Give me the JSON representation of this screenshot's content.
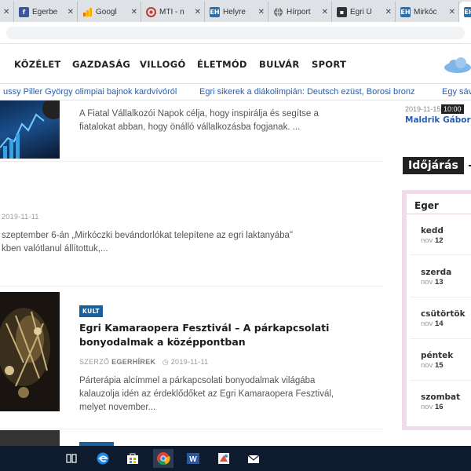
{
  "tabs": [
    {
      "title": "",
      "fav": "x-icon",
      "color": "#dee1e6"
    },
    {
      "title": "Egerbe",
      "fav": "facebook-icon",
      "color": "#3b5998"
    },
    {
      "title": "Googl",
      "fav": "google-analytics-icon",
      "color": "#f9ab00"
    },
    {
      "title": "MTI - n",
      "fav": "mti-icon",
      "color": "#c0392b"
    },
    {
      "title": "Helyre",
      "fav": "eh-icon",
      "color": "#2a6fb0"
    },
    {
      "title": "Hírport",
      "fav": "globe-icon",
      "color": "#777777"
    },
    {
      "title": "Egri Ü",
      "fav": "page-icon",
      "color": "#333333"
    },
    {
      "title": "Mirkóc",
      "fav": "eh-icon",
      "color": "#2a6fb0"
    },
    {
      "title": "",
      "fav": "eh-icon",
      "color": "#2a6fb0"
    }
  ],
  "nav": [
    "KÖZÉLET",
    "GAZDASÁG",
    "VILLOGÓ",
    "ÉLETMÓD",
    "BULVÁR",
    "SPORT"
  ],
  "ticker": [
    "ussy Piller György olimpiai bajnok kardvívóról",
    "Egri sikerek a diákolimpián: Deutsch ezüst, Borosi bronz",
    "Egy sáv"
  ],
  "articles": {
    "a1": {
      "excerpt": [
        "A Fiatal Vállalkozói Napok célja, hogy inspirálja és segítse a",
        "fiatalokat abban, hogy önálló vállalkozásba fogjanak. ..."
      ]
    },
    "a2": {
      "date": "2019-11-11",
      "excerpt": [
        "szeptember 6-án „Mirkóczki bevándorlókat telepítene az egri laktanyába\"",
        "kben valótlanul állítottuk,..."
      ]
    },
    "a3": {
      "badge": "KULT",
      "headline": [
        "Egri Kamaraopera Fesztivál – A párkapcsolati",
        "bonyodalmak a középpontban"
      ],
      "author_label": "SZERZŐ",
      "author": "EGERHÍREK",
      "date": "2019-11-11",
      "excerpt": [
        "Párterápia alcímmel a párkapcsolati bonyodalmak világába",
        "kalauzolja idén az érdeklődőket az Egri Kamaraopera Fesztivál,",
        "melyet november..."
      ]
    }
  },
  "sidebar": {
    "date": "2019-11-15",
    "time": "10:00",
    "link": "Maldrik Gábor k",
    "weather_title": "Időjárás",
    "city": "Eger",
    "days": [
      {
        "day": "kedd",
        "month": "nov",
        "num": "12"
      },
      {
        "day": "szerda",
        "month": "nov",
        "num": "13"
      },
      {
        "day": "csütörtök",
        "month": "nov",
        "num": "14"
      },
      {
        "day": "péntek",
        "month": "nov",
        "num": "15"
      },
      {
        "day": "szombat",
        "month": "nov",
        "num": "16"
      }
    ]
  },
  "taskbar": [
    "task-view-icon",
    "edge-icon",
    "store-icon",
    "chrome-icon",
    "word-icon",
    "paint-icon",
    "mail-icon"
  ]
}
